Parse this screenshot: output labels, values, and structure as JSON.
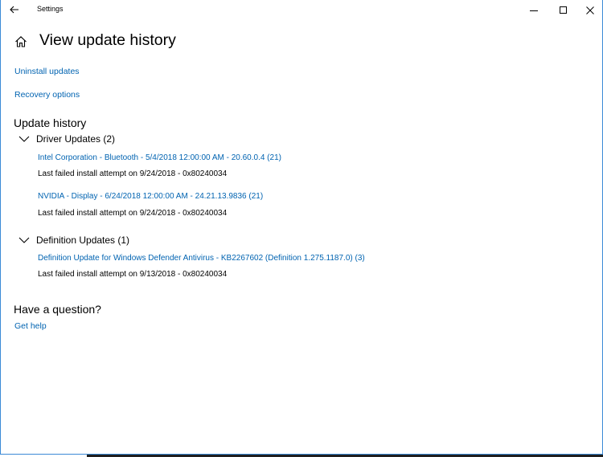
{
  "window": {
    "title": "Settings",
    "controls": {
      "minimize_icon": "minimize-icon",
      "maximize_icon": "maximize-icon",
      "close_icon": "close-icon"
    }
  },
  "page": {
    "title": "View update history",
    "links": {
      "uninstall": "Uninstall updates",
      "recovery": "Recovery options"
    }
  },
  "history": {
    "heading": "Update history",
    "groups": [
      {
        "label": "Driver Updates (2)",
        "items": [
          {
            "name": "Intel Corporation - Bluetooth - 5/4/2018 12:00:00 AM - 20.60.0.4 (21)",
            "status": "Last failed install attempt on 9/24/2018 - 0x80240034"
          },
          {
            "name": "NVIDIA - Display - 6/24/2018 12:00:00 AM - 24.21.13.9836 (21)",
            "status": "Last failed install attempt on 9/24/2018 - 0x80240034"
          }
        ]
      },
      {
        "label": "Definition Updates (1)",
        "items": [
          {
            "name": "Definition Update for Windows Defender Antivirus - KB2267602 (Definition 1.275.1187.0) (3)",
            "status": "Last failed install attempt on 9/13/2018 - 0x80240034"
          }
        ]
      }
    ]
  },
  "help": {
    "heading": "Have a question?",
    "link": "Get help"
  },
  "colors": {
    "link": "#0063b1",
    "window_border": "#3b8ad6",
    "text": "#000000"
  }
}
